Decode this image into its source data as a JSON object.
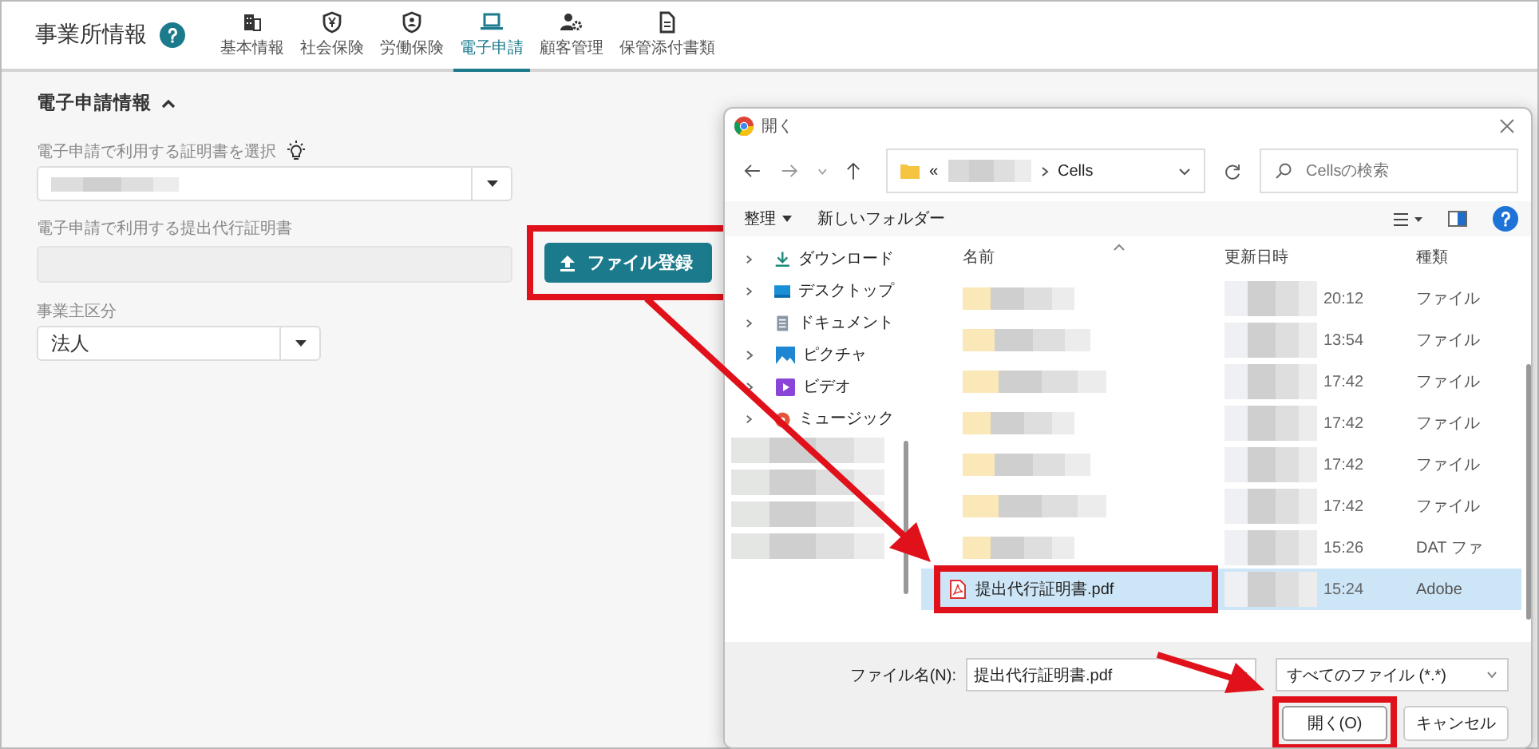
{
  "header": {
    "title": "事業所情報",
    "tabs": [
      {
        "label": "基本情報",
        "selected": false
      },
      {
        "label": "社会保険",
        "selected": false
      },
      {
        "label": "労働保険",
        "selected": false
      },
      {
        "label": "電子申請",
        "selected": true
      },
      {
        "label": "顧客管理",
        "selected": false
      },
      {
        "label": "保管添付書類",
        "selected": false
      }
    ]
  },
  "section": {
    "title": "電子申請情報",
    "expanded": true,
    "fields": [
      {
        "kind": "select",
        "label": "電子申請で利用する証明書を選択",
        "value_redacted": true
      },
      {
        "kind": "file",
        "label": "電子申請で利用する提出代行証明書",
        "disabled": true,
        "button": {
          "label": "ファイル登録",
          "highlighted": true
        }
      },
      {
        "kind": "select",
        "label": "事業主区分",
        "value": "法人"
      }
    ]
  },
  "dialog": {
    "title": "開く",
    "path": {
      "prefix": "«",
      "redacted": true,
      "folder": "Cells"
    },
    "search": {
      "placeholder": "Cellsの検索"
    },
    "toolbar": [
      {
        "label": "整理",
        "dropdown": true
      },
      {
        "label": "新しいフォルダー",
        "dropdown": false
      }
    ],
    "nav": [
      {
        "kind": "folder",
        "label": "ダウンロード"
      },
      {
        "kind": "folder",
        "label": "デスクトップ"
      },
      {
        "kind": "folder",
        "label": "ドキュメント"
      },
      {
        "kind": "folder",
        "label": "ピクチャ"
      },
      {
        "kind": "folder",
        "label": "ビデオ"
      },
      {
        "kind": "folder",
        "label": "ミュージック"
      },
      {
        "kind": "redacted"
      },
      {
        "kind": "redacted"
      },
      {
        "kind": "redacted"
      },
      {
        "kind": "redacted"
      }
    ],
    "columns": [
      {
        "label": "名前",
        "sorted": true
      },
      {
        "label": "更新日時",
        "sorted": false
      },
      {
        "label": "種類",
        "sorted": false
      }
    ],
    "rows": [
      {
        "kind": "redacted",
        "time": "20:12",
        "type": "ファイル",
        "selected": false
      },
      {
        "kind": "redacted",
        "time": "13:54",
        "type": "ファイル",
        "selected": false
      },
      {
        "kind": "redacted",
        "time": "17:42",
        "type": "ファイル",
        "selected": false
      },
      {
        "kind": "redacted",
        "time": "17:42",
        "type": "ファイル",
        "selected": false
      },
      {
        "kind": "redacted",
        "time": "17:42",
        "type": "ファイル",
        "selected": false
      },
      {
        "kind": "redacted",
        "time": "17:42",
        "type": "ファイル",
        "selected": false
      },
      {
        "kind": "redacted",
        "time": "15:26",
        "type": "DAT ファ",
        "selected": false
      },
      {
        "kind": "file",
        "name": "提出代行証明書.pdf",
        "time": "15:24",
        "type": "Adobe",
        "selected": true,
        "highlighted": true
      }
    ],
    "filename": {
      "label": "ファイル名(N):",
      "value": "提出代行証明書.pdf"
    },
    "filter": {
      "value": "すべてのファイル (*.*)"
    },
    "buttons": [
      {
        "label": "開く(O)",
        "kind": "primary",
        "highlighted": true
      },
      {
        "label": "キャンセル",
        "kind": "secondary",
        "highlighted": false
      }
    ]
  }
}
